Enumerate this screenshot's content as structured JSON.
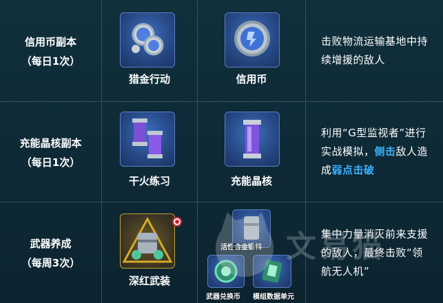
{
  "rows": [
    {
      "name": "信用币副本",
      "freq": "（每日1次）",
      "item1": "猎金行动",
      "item2": "信用币",
      "desc": "击败物流运输基地中持续增援的敌人"
    },
    {
      "name": "充能晶核副本",
      "freq": "（每日1次）",
      "item1": "干火练习",
      "item2": "充能晶核",
      "desc_pre": "利用“G型监视者”进行实战模拟，",
      "desc_hl1": "侧击",
      "desc_mid": "敌人造成",
      "desc_hl2": "弱点击破"
    },
    {
      "name": "武器养成",
      "freq": "（每周3次）",
      "item1": "深红武装",
      "item2a": "活性合金锻料",
      "item2b": "武器兑换币",
      "item2c": "模组数据单元",
      "desc": "集中力量消灭前来支援的敌人，最终击败“领航无人机”"
    }
  ],
  "watermark": "文易猫",
  "colors": {
    "highlight": "#3cb2ff",
    "grid": "#37505c",
    "bg": "#0d2430"
  }
}
